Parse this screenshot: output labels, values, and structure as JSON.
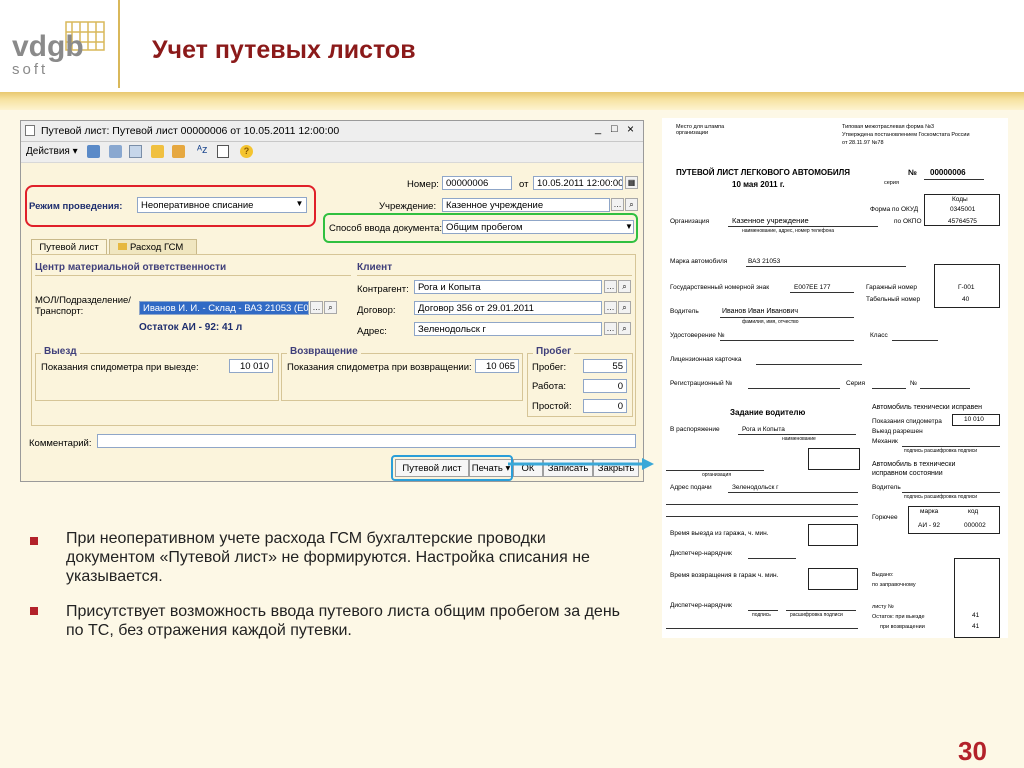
{
  "slide": {
    "logo_top": "vdgb",
    "logo_bottom": "soft",
    "title": "Учет путевых листов",
    "page_number": "30"
  },
  "window": {
    "title": "Путевой лист: Путевой лист 00000006 от 10.05.2011 12:00:00",
    "controls": [
      "_",
      "□",
      "×"
    ],
    "toolbar": {
      "actions_label": "Действия ▾"
    },
    "header_fields": {
      "mode_label": "Режим проведения:",
      "mode_value": "Неоперативное списание",
      "number_label": "Номер:",
      "number_value": "00000006",
      "date_label": "от",
      "date_value": "10.05.2011 12:00:00",
      "org_label": "Учреждение:",
      "org_value": "Казенное учреждение",
      "input_method_label": "Способ ввода документа:",
      "input_method_value": "Общим пробегом"
    },
    "tabs": [
      "Путевой лист",
      "Расход ГСМ"
    ],
    "responsibility": {
      "title": "Центр материальной ответственности",
      "mol_label": "МОЛ/Подразделение/ Транспорт:",
      "mol_value": "Иванов И. И. - Склад - ВАЗ 21053 (Е0С",
      "balance": "Остаток АИ - 92: 41 л"
    },
    "client": {
      "title": "Клиент",
      "counterparty_label": "Контрагент:",
      "counterparty_value": "Рога и Копыта",
      "contract_label": "Договор:",
      "contract_value": "Договор 356 от 29.01.2011",
      "address_label": "Адрес:",
      "address_value": "Зеленодольск г"
    },
    "departure": {
      "title": "Выезд",
      "label": "Показания спидометра при выезде:",
      "value": "10 010"
    },
    "return": {
      "title": "Возвращение",
      "label": "Показания спидометра при возвращении:",
      "value": "10 065"
    },
    "mileage": {
      "title": "Пробег",
      "run_label": "Пробег:",
      "run_value": "55",
      "work_label": "Работа:",
      "work_value": "0",
      "idle_label": "Простой:",
      "idle_value": "0"
    },
    "comment_label": "Комментарий:",
    "footer_buttons": [
      "Путевой лист",
      "Печать ▾",
      "ОК",
      "Записать",
      "Закрыть"
    ]
  },
  "bullets": [
    "При неоперативном учете расхода ГСМ бухгалтерские проводки документом «Путевой лист» не формируются. Настройка списания не указывается.",
    "Присутствует возможность ввода путевого листа общим пробегом за день по ТС, без отражения каждой путевки."
  ],
  "document": {
    "top_left": "Место для штампа организации",
    "top_right_1": "Типовая межотраслевая форма №3",
    "top_right_2": "Утверждена постановлением Госкомстата России",
    "top_right_3": "от 28.11.97 №78",
    "title": "ПУТЕВОЙ ЛИСТ ЛЕГКОВОГО АВТОМОБИЛЯ",
    "number_sign": "№",
    "number": "00000006",
    "date": "10 мая 2011 г.",
    "series": "серия",
    "codes": "Коды",
    "okud_label": "Форма по ОКУД",
    "okud": "0345001",
    "okpo_label": "по ОКПО",
    "okpo": "45764575",
    "org_label": "Организация",
    "org_value": "Казенное учреждение",
    "org_caption": "наименование, адрес, номер телефона",
    "car_label": "Марка автомобиля",
    "car_value": "ВАЗ 21053",
    "plate_label": "Государственный номерной знак",
    "plate_value": "Е007ЕЕ 177",
    "garage_label": "Гаражный номер",
    "garage_value": "Г-001",
    "tab_label": "Табельный номер",
    "tab_value": "40",
    "driver_label": "Водитель",
    "driver_value": "Иванов Иван Иванович",
    "driver_caption": "фамилия, имя, отчество",
    "license_label": "Удостоверение №",
    "class_label": "Класс",
    "card_label": "Лицензионная карточка",
    "reg_label": "Регистрационный №",
    "series_label": "Серия",
    "no_label": "№",
    "task_title": "Задание водителю",
    "disposal_label": "В распоряжение",
    "disposal_value": "Рога и Копыта",
    "disposal_caption": "наименование",
    "org_caption2": "организация",
    "address_label": "Адрес подачи",
    "address_value": "Зеленодольск г",
    "tech_ok": "Автомобиль технически исправен",
    "speedo_label": "Показания спидометра",
    "speedo_value": "10 010",
    "exit_allowed": "Выезд разрешен",
    "mechanic": "Механик",
    "sign_caption": "подпись   расшифровка подписи",
    "tech_ok_2": "Автомобиль в технически исправном состоянии",
    "driver2": "Водитель",
    "fuel_label": "Горючее",
    "brand_h": "марка",
    "code_h": "код",
    "brand_v": "АИ - 92",
    "code_v": "000002",
    "exit_time": "Время выезда из гаража, ч. мин.",
    "dispatcher1": "Диспетчер-нарядчик",
    "return_time": "Время возвращения в гараж ч. мин.",
    "dispatcher2": "Диспетчер-нарядчик",
    "sign2": "подпись",
    "sign2b": "расшифровка подписи",
    "issued": "Выдано:",
    "by_order": "по заправочному",
    "list_no": "листу №",
    "remain_exit": "Остаток: при выезде",
    "remain_exit_v": "41",
    "remain_return": "при возвращении",
    "remain_return_v": "41"
  }
}
